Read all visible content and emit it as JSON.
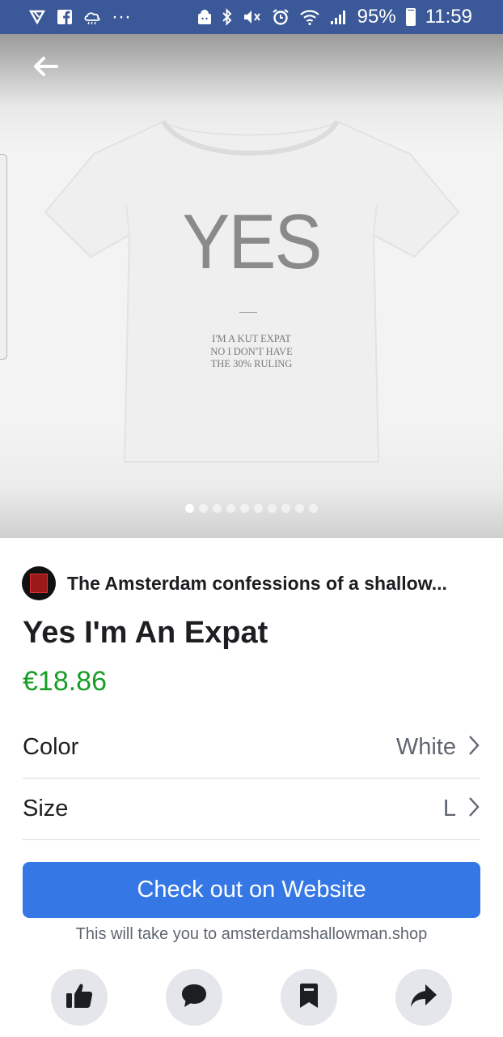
{
  "status_bar": {
    "battery": "95%",
    "battery_level": 0.95,
    "time": "11:59",
    "more": "···",
    "left_icons": [
      "app-notification-icon",
      "facebook-icon",
      "weather-icon",
      "more-icon"
    ],
    "right_icons": [
      "android-icon",
      "bluetooth-icon",
      "mute-icon",
      "alarm-icon",
      "wifi-icon",
      "signal-icon",
      "battery-icon"
    ]
  },
  "hero": {
    "back_icon": "arrow-left-icon",
    "shirt_headline": "YES",
    "shirt_lines": [
      "I'M A KUT EXPAT",
      "NO I DON'T HAVE",
      "THE 30% RULING"
    ],
    "image_count": 10,
    "active_image": 1
  },
  "product": {
    "seller_name": "The Amsterdam confessions of a shallow...",
    "title": "Yes I'm An Expat",
    "price": "€18.86"
  },
  "options": [
    {
      "label": "Color",
      "value": "White"
    },
    {
      "label": "Size",
      "value": "L"
    }
  ],
  "cta": {
    "label": "Check out on Website",
    "note": "This will take you to amsterdamshallowman.shop"
  },
  "actions": [
    {
      "icon": "thumbs-up-icon"
    },
    {
      "icon": "comment-icon"
    },
    {
      "icon": "bookmark-icon"
    },
    {
      "icon": "share-icon"
    }
  ],
  "colors": {
    "status_bar": "#3b5998",
    "price": "#1a9e28",
    "cta": "#3578e5"
  }
}
